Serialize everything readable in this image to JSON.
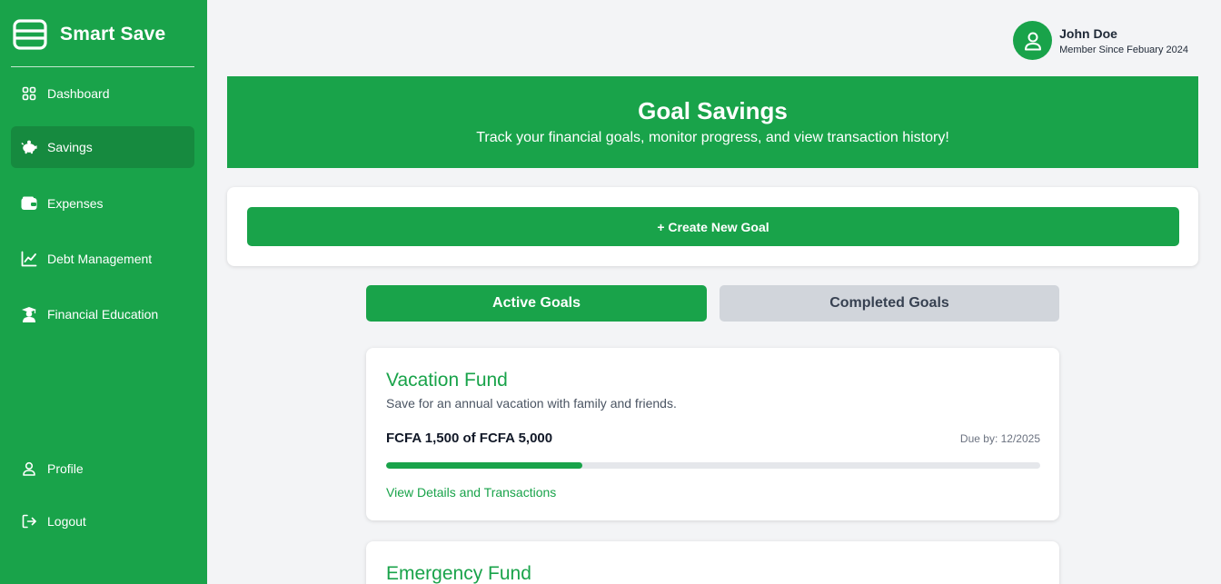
{
  "brand": {
    "name": "Smart Save"
  },
  "sidebar": {
    "items": [
      {
        "label": "Dashboard",
        "icon": "grid-icon",
        "active": false
      },
      {
        "label": "Savings",
        "icon": "piggy-bank-icon",
        "active": true
      },
      {
        "label": "Expenses",
        "icon": "wallet-icon",
        "active": false
      },
      {
        "label": "Debt Management",
        "icon": "chart-line-icon",
        "active": false
      },
      {
        "label": "Financial Education",
        "icon": "graduate-icon",
        "active": false
      }
    ],
    "bottom_items": [
      {
        "label": "Profile",
        "icon": "user-icon"
      },
      {
        "label": "Logout",
        "icon": "logout-icon"
      }
    ]
  },
  "user": {
    "name": "John Doe",
    "member_since": "Member Since Febuary 2024"
  },
  "banner": {
    "title": "Goal Savings",
    "subtitle": "Track your financial goals, monitor progress, and view transaction history!"
  },
  "actions": {
    "create_goal": "+ Create New Goal"
  },
  "tabs": {
    "active": "Active Goals",
    "completed": "Completed Goals"
  },
  "goals": [
    {
      "title": "Vacation Fund",
      "description": "Save for an annual vacation with family and friends.",
      "amount_text": "FCFA 1,500 of FCFA 5,000",
      "due": "Due by: 12/2025",
      "progress": 0.3,
      "link": "View Details and Transactions"
    },
    {
      "title": "Emergency Fund"
    }
  ],
  "colors": {
    "primary": "#19a34a",
    "primary_dark": "#168a3f",
    "background": "#f3f4f6",
    "tab_inactive": "#d1d5db"
  }
}
